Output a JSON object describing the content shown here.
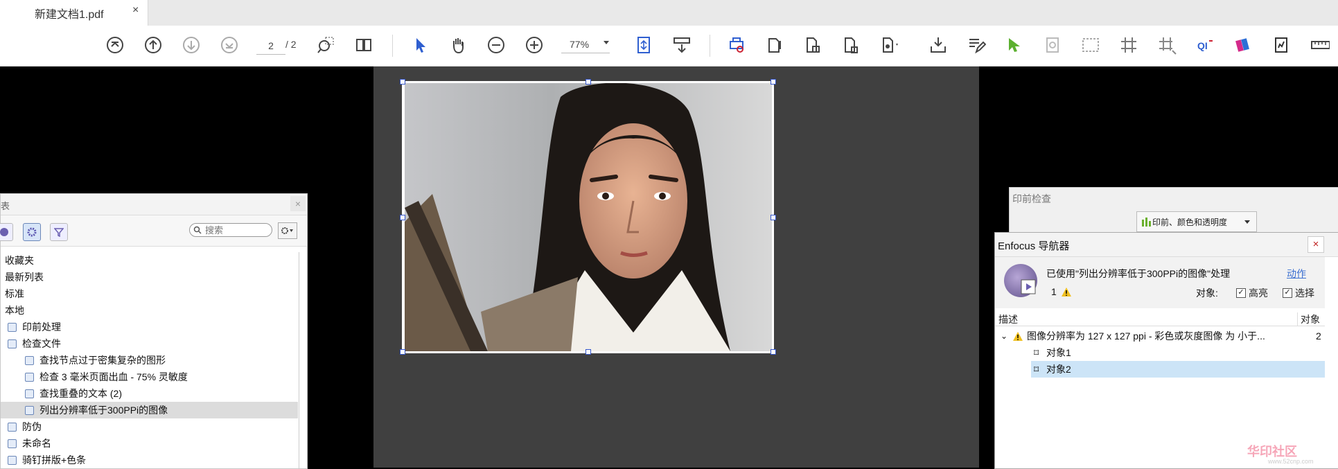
{
  "tab": {
    "title": "新建文档1.pdf",
    "close": "×"
  },
  "toolbar": {
    "page_current": "2",
    "page_total": "/ 2",
    "zoom": "77%"
  },
  "left_panel": {
    "title": "表",
    "close": "×",
    "search_placeholder": "搜索",
    "items": [
      {
        "label": "收藏夹",
        "indent": 0,
        "icon": false
      },
      {
        "label": "最新列表",
        "indent": 0,
        "icon": false
      },
      {
        "label": "标准",
        "indent": 0,
        "icon": false
      },
      {
        "label": "本地",
        "indent": 0,
        "icon": false
      },
      {
        "label": "印前处理",
        "indent": 1,
        "icon": true
      },
      {
        "label": "检查文件",
        "indent": 1,
        "icon": true
      },
      {
        "label": "查找节点过于密集复杂的图形",
        "indent": 2,
        "icon": true
      },
      {
        "label": "检查 3 毫米页面出血 - 75% 灵敏度",
        "indent": 2,
        "icon": true
      },
      {
        "label": "查找重叠的文本 (2)",
        "indent": 2,
        "icon": true
      },
      {
        "label": "列出分辨率低于300PPi的图像",
        "indent": 2,
        "icon": true,
        "selected": true
      },
      {
        "label": "防伪",
        "indent": 1,
        "icon": true
      },
      {
        "label": "未命名",
        "indent": 1,
        "icon": true
      },
      {
        "label": "骑钉拼版+色条",
        "indent": 1,
        "icon": true
      }
    ]
  },
  "preflight": {
    "title": "印前检查",
    "dropdown": "印前、颜色和透明度"
  },
  "navigator": {
    "title": "Enfocus 导航器",
    "close": "×",
    "message": "已使用\"列出分辨率低于300PPi的图像\"处理",
    "action": "动作",
    "count": "1",
    "objects_label": "对象:",
    "highlight": "高亮",
    "select": "选择",
    "col_desc": "描述",
    "col_obj": "对象",
    "row_main": "图像分辨率为 127 x 127 ppi - 彩色或灰度图像 为 小于...",
    "row_main_count": "2",
    "row_obj1": "对象1",
    "row_obj2": "对象2"
  },
  "colors": {
    "accent": "#2f5fd0",
    "selection": "#cce4f7",
    "doc_bg": "#404040"
  },
  "watermark": {
    "text": "华印社区",
    "url": "www.52cnp.com"
  }
}
